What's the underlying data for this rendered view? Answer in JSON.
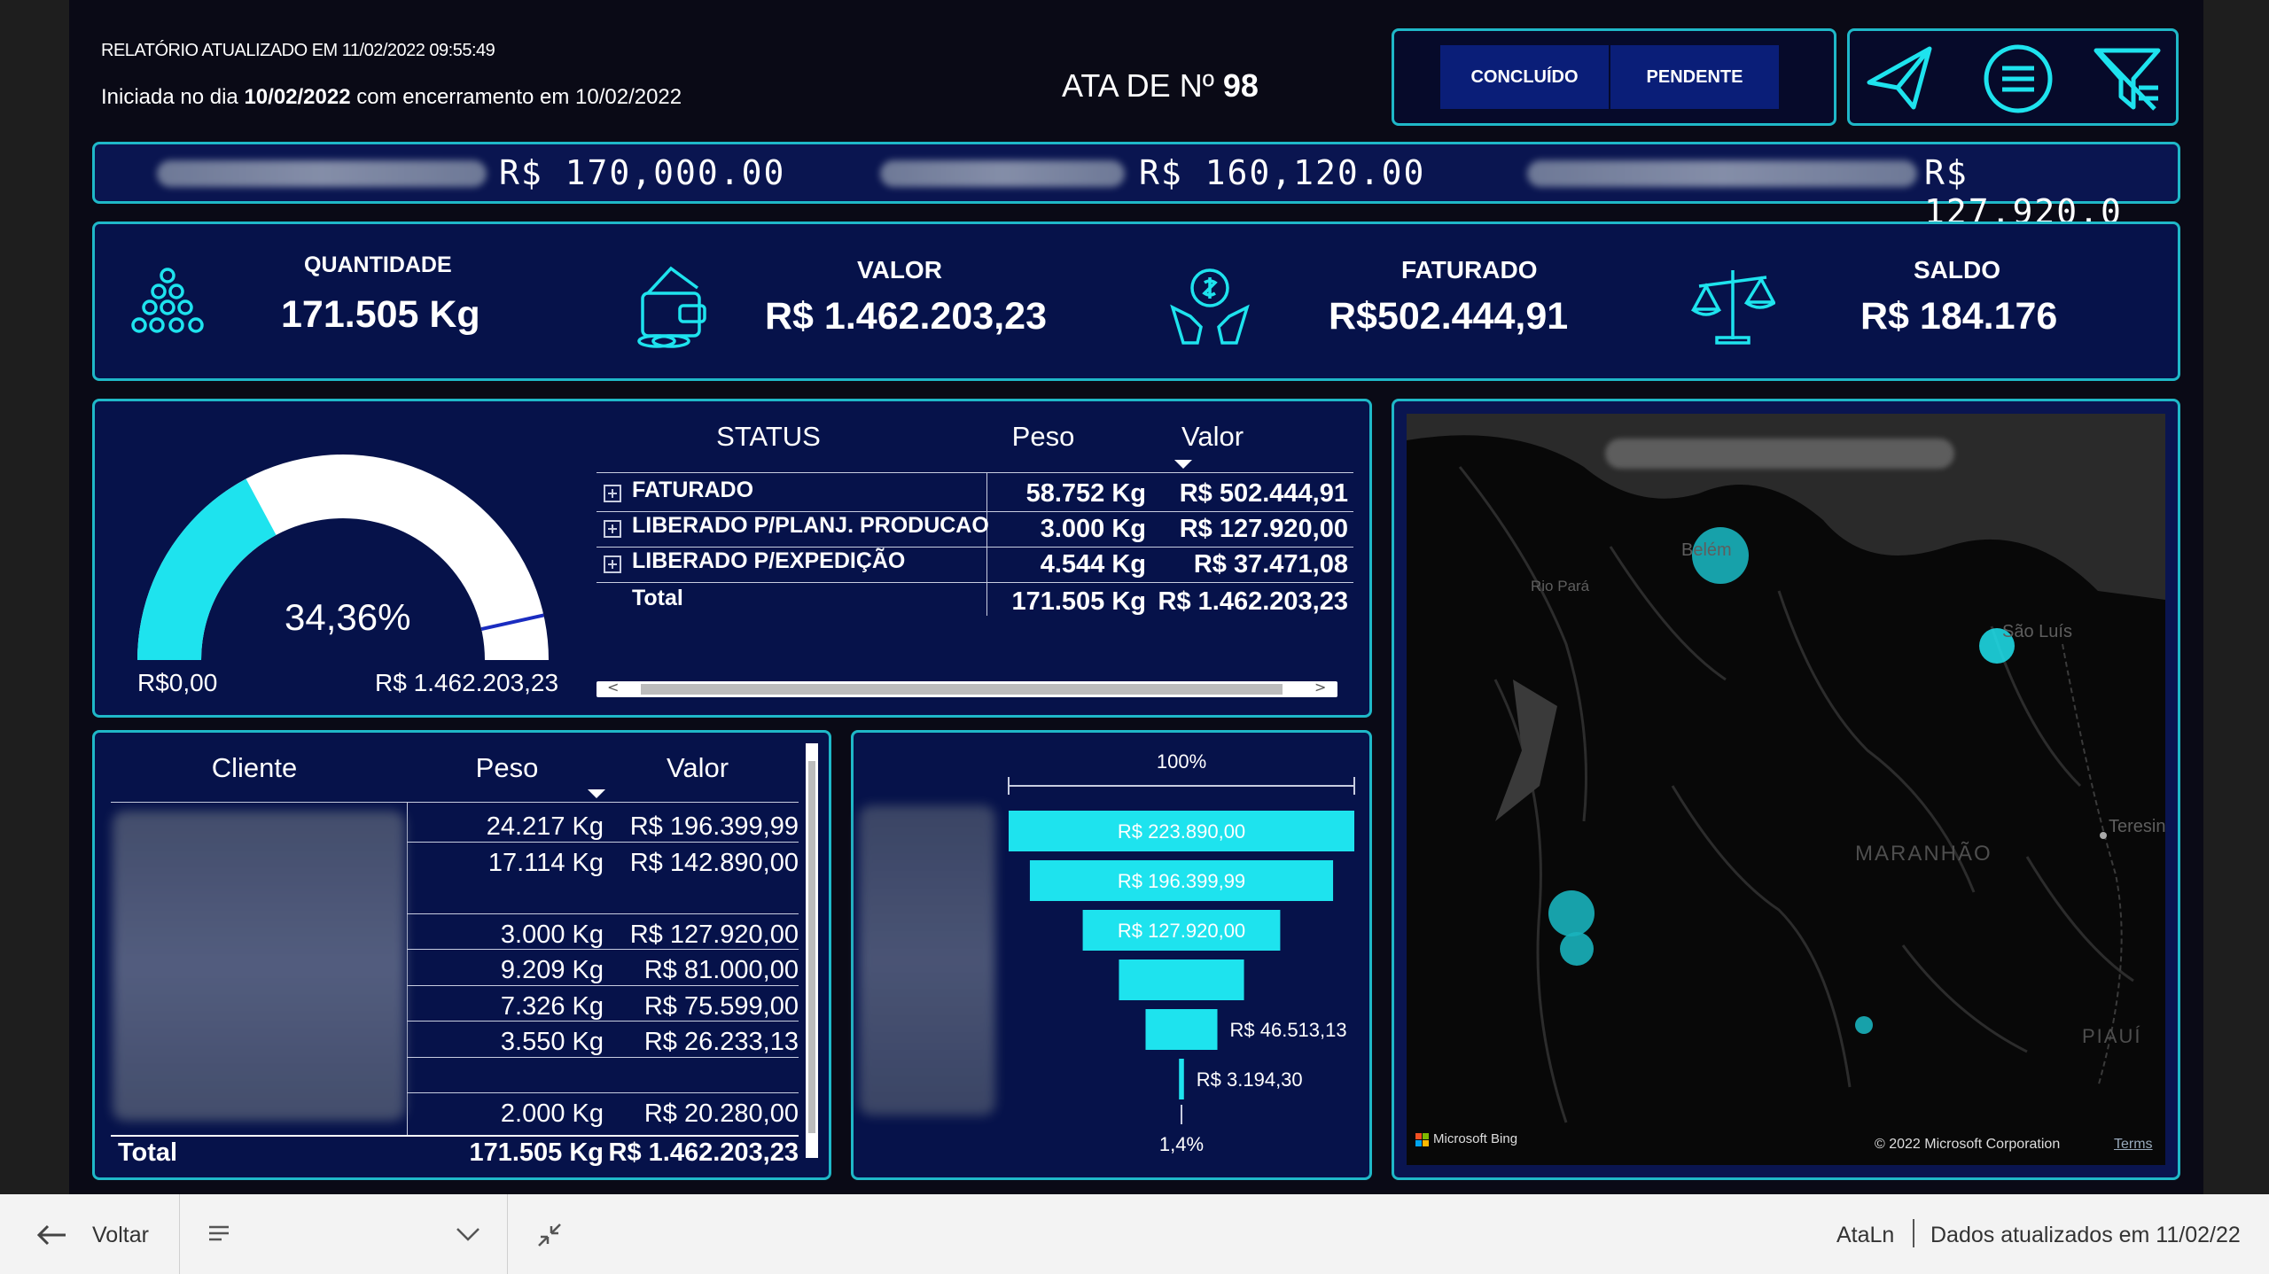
{
  "header": {
    "updated": "RELATÓRIO ATUALIZADO EM 11/02/2022 09:55:49",
    "started_prefix": "Iniciada no dia",
    "started_date": "10/02/2022",
    "started_mid": "com encerramento em 10/02/2022",
    "ata_label": "ATA DE Nº",
    "ata_number": "98",
    "btn_concluido": "CONCLUÍDO",
    "btn_pendente": "PENDENTE"
  },
  "ticker": {
    "values": [
      "R$  170,000.00",
      "R$  160,120.00",
      "R$  127,920.0"
    ]
  },
  "kpis": [
    {
      "label": "QUANTIDADE",
      "value": "171.505 Kg",
      "icon": "coins-pyramid-icon"
    },
    {
      "label": "VALOR",
      "value": "R$ 1.462.203,23",
      "icon": "wallet-icon"
    },
    {
      "label": "FATURADO",
      "value": "R$502.444,91",
      "icon": "money-hands-icon"
    },
    {
      "label": "SALDO",
      "value": "R$ 184.176",
      "icon": "balance-scale-icon"
    }
  ],
  "gauge": {
    "percent_label": "34,36%",
    "min_label": "R$0,00",
    "max_label": "R$ 1.462.203,23",
    "fraction": 0.3436,
    "target_fraction": 0.93
  },
  "status_table": {
    "headers": [
      "STATUS",
      "Peso",
      "Valor"
    ],
    "rows": [
      {
        "status": "FATURADO",
        "peso": "58.752 Kg",
        "valor": "R$ 502.444,91"
      },
      {
        "status": "LIBERADO P/PLANJ. PRODUCAO",
        "peso": "3.000 Kg",
        "valor": "R$ 127.920,00"
      },
      {
        "status": "LIBERADO P/EXPEDIÇÃO",
        "peso": "4.544 Kg",
        "valor": "R$ 37.471,08"
      }
    ],
    "total": {
      "status": "Total",
      "peso": "171.505 Kg",
      "valor": "R$ 1.462.203,23"
    }
  },
  "client_table": {
    "headers": [
      "Cliente",
      "Peso",
      "Valor"
    ],
    "rows": [
      {
        "peso": "24.217 Kg",
        "valor": "R$ 196.399,99"
      },
      {
        "peso": "17.114 Kg",
        "valor": "R$ 142.890,00"
      },
      {
        "peso": "",
        "valor": ""
      },
      {
        "peso": "3.000 Kg",
        "valor": "R$ 127.920,00"
      },
      {
        "peso": "9.209 Kg",
        "valor": "R$ 81.000,00"
      },
      {
        "peso": "7.326 Kg",
        "valor": "R$ 75.599,00"
      },
      {
        "peso": "3.550 Kg",
        "valor": "R$ 26.233,13"
      },
      {
        "peso": "",
        "valor": ""
      },
      {
        "peso": "2.000 Kg",
        "valor": "R$ 20.280,00"
      }
    ],
    "total": {
      "label": "Total",
      "peso": "171.505 Kg",
      "valor": "R$ 1.462.203,23"
    }
  },
  "chart_data": {
    "type": "bar",
    "subtype": "funnel",
    "top_label": "100%",
    "bottom_label": "1,4%",
    "values": [
      223890.0,
      196399.99,
      127920.0,
      81000.0,
      46513.13,
      3194.3
    ],
    "labels": [
      "R$ 223.890,00",
      "R$ 196.399,99",
      "R$ 127.920,00",
      "",
      "R$ 46.513,13",
      "R$ 3.194,30"
    ],
    "color": "#1ee3ee"
  },
  "map": {
    "labels": [
      "Belém",
      "Rio Pará",
      "São Luís",
      "Teresin",
      "MARANHÃO",
      "PIAUÍ"
    ],
    "bing": "Microsoft Bing",
    "copyright": "© 2022 Microsoft Corporation",
    "terms": "Terms"
  },
  "bottom": {
    "back": "Voltar",
    "report": "AtaLn",
    "updated": "Dados atualizados em 11/02/22"
  },
  "colors": {
    "accent": "#1ee3ee",
    "border": "#1fb8c8",
    "panel": "#06124a"
  }
}
